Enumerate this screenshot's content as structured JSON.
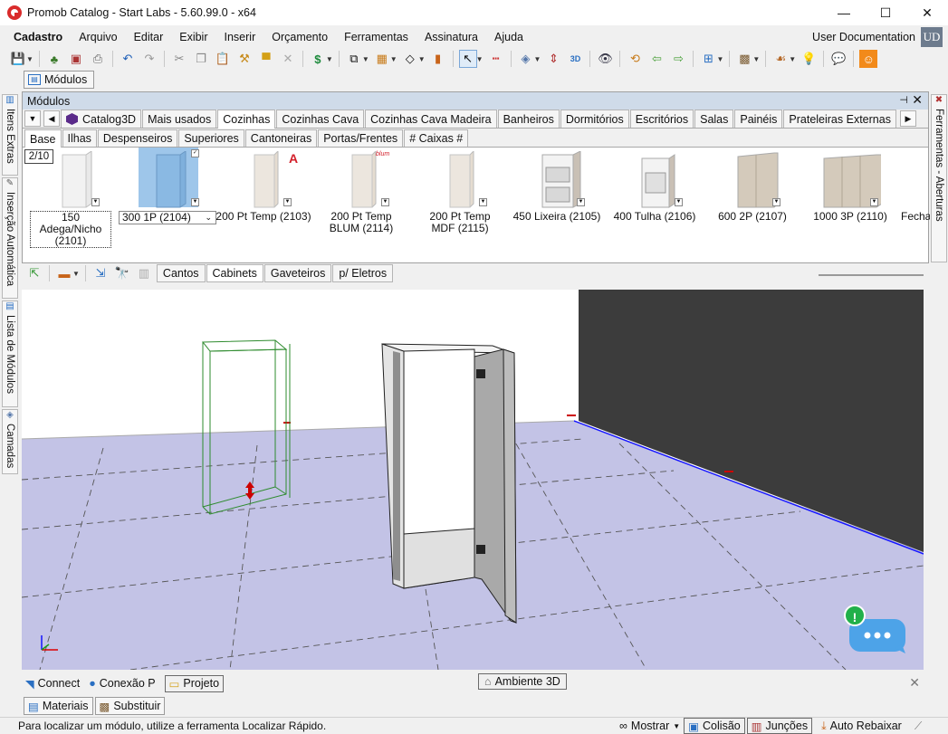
{
  "window": {
    "title": "Promob Catalog - Start Labs - 5.60.99.0 - x64",
    "minimize": "—",
    "maximize": "☐",
    "close": "✕"
  },
  "menu": [
    "Cadastro",
    "Arquivo",
    "Editar",
    "Exibir",
    "Inserir",
    "Orçamento",
    "Ferramentas",
    "Assinatura",
    "Ajuda"
  ],
  "user": {
    "doc_label": "User Documentation",
    "initials": "UD"
  },
  "document_tab": "Módulos",
  "left_tabs": [
    "Itens Extras",
    "Inserção Automática",
    "Lista de Módulos",
    "Camadas"
  ],
  "right_tab": "Ferramentas - Aberturas",
  "modulos": {
    "title": "Módulos",
    "category_tabs": [
      "Catalog3D",
      "Mais usados",
      "Cozinhas",
      "Cozinhas Cava",
      "Cozinhas Cava Madeira",
      "Banheiros",
      "Dormitórios",
      "Escritórios",
      "Salas",
      "Painéis",
      "Prateleiras Externas"
    ],
    "active_category": "Cozinhas",
    "sub_tabs": [
      "Base",
      "Ilhas",
      "Despenseiros",
      "Superiores",
      "Cantoneiras",
      "Portas/Frentes",
      "# Caixas #"
    ],
    "active_sub": "Base",
    "page": "2/10",
    "items": [
      {
        "label": "150 Adega/Nicho (2101)"
      },
      {
        "label": "300 1P (2104)"
      },
      {
        "label": "200 Pt Temp (2103)"
      },
      {
        "label": "200 Pt Temp BLUM (2114)"
      },
      {
        "label": "200 Pt Temp MDF (2115)"
      },
      {
        "label": "450 Lixeira (2105)"
      },
      {
        "label": "400 Tulha (2106)"
      },
      {
        "label": "600 2P (2107)"
      },
      {
        "label": "1000 3P (2110)"
      },
      {
        "label": "Fecha"
      }
    ],
    "blum_tag": "blum"
  },
  "viewer_tabs": [
    "Cantos",
    "Cabinets",
    "Gaveteiros",
    "p/ Eletros"
  ],
  "active_viewer_tab": "Cabinets",
  "bottom": {
    "connect": "Connect",
    "conexao": "Conexão P",
    "projeto": "Projeto",
    "ambiente": "Ambiente 3D",
    "close": "✕"
  },
  "lower_tabs": [
    "Materiais",
    "Substituir"
  ],
  "status": {
    "text": "Para localizar um módulo, utilize a ferramenta Localizar Rápido.",
    "mostrar": "Mostrar",
    "colisao": "Colisão",
    "juncoes": "Junções",
    "auto_rebaixar": "Auto Rebaixar"
  },
  "chat": {
    "badge": "!"
  },
  "colors": {
    "accent": "#cfdbe9",
    "selected": "#9ec6ea",
    "floor": "#c3c3e6",
    "wall": "#3c3c3c"
  }
}
